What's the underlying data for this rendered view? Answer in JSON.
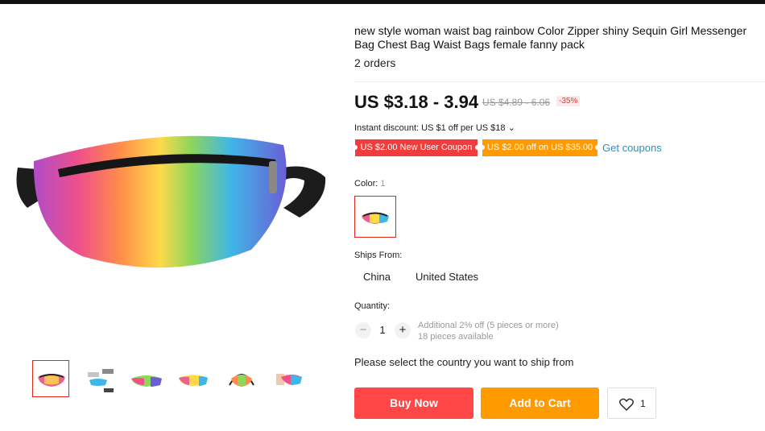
{
  "product": {
    "title": "new style woman waist bag rainbow Color Zipper shiny Sequin Girl Messenger Bag Chest Bag Waist Bags female fanny pack",
    "orders": "2 orders",
    "price": "US $3.18 - 3.94",
    "original_price": "US $4.89 - 6.06",
    "discount_pct": "-35%"
  },
  "promo": {
    "instant_discount": "Instant discount: US $1 off per US $18 ⌄",
    "coupon_new_user": "US $2.00 New User Coupon",
    "coupon_spend": "US $2.00 off on US $35.00",
    "get_coupons": "Get coupons"
  },
  "options": {
    "color_label": "Color:",
    "color_count": "1",
    "ships_label": "Ships From:",
    "ships_options": [
      "China",
      "United States"
    ]
  },
  "quantity": {
    "label": "Quantity:",
    "minus": "−",
    "value": "1",
    "plus": "+",
    "additional": "Additional 2% off (5 pieces or more)",
    "available": "18 pieces available"
  },
  "select_country": "Please select the country you want to ship from",
  "actions": {
    "buy_now": "Buy Now",
    "add_to_cart": "Add to Cart",
    "wishlist_count": "1"
  },
  "colors": {
    "brand_red": "#ff4747",
    "brand_orange": "#ff9a00",
    "link_blue": "#2a8fbd"
  },
  "icons": {
    "wishlist": "heart-icon",
    "thumbnail_count": 6
  }
}
